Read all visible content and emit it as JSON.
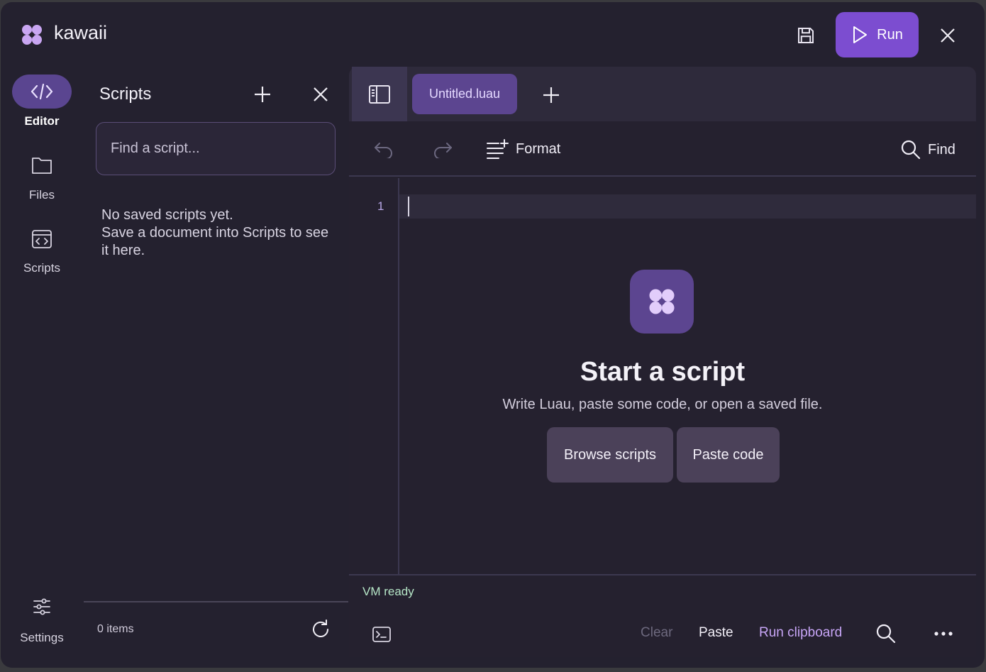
{
  "header": {
    "app_title": "kawaii",
    "run_label": "Run"
  },
  "rail": {
    "items": [
      {
        "label": "Editor",
        "icon": "code-icon",
        "active": true
      },
      {
        "label": "Files",
        "icon": "folder-icon",
        "active": false
      },
      {
        "label": "Scripts",
        "icon": "code-window-icon",
        "active": false
      }
    ],
    "settings_label": "Settings"
  },
  "scripts_panel": {
    "title": "Scripts",
    "search_placeholder": "Find a script...",
    "empty_line1": "No saved scripts yet.",
    "empty_line2": "Save a document into Scripts to see it here.",
    "item_count": "0 items"
  },
  "editor": {
    "tabs": [
      {
        "label": "Untitled.luau",
        "active": true
      }
    ],
    "toolbar": {
      "format_label": "Format",
      "find_label": "Find"
    },
    "line_numbers": [
      "1"
    ],
    "empty_state": {
      "title": "Start a script",
      "subtitle": "Write Luau, paste some code, or open a saved file.",
      "browse_label": "Browse scripts",
      "paste_label": "Paste code"
    },
    "status": "VM ready",
    "bottom": {
      "clear_label": "Clear",
      "paste_label": "Paste",
      "run_clipboard_label": "Run clipboard"
    }
  },
  "colors": {
    "accent": "#7c4dd0",
    "background": "#24212f",
    "tab_active": "#5c4590",
    "status_ok": "#b6e6c7"
  }
}
